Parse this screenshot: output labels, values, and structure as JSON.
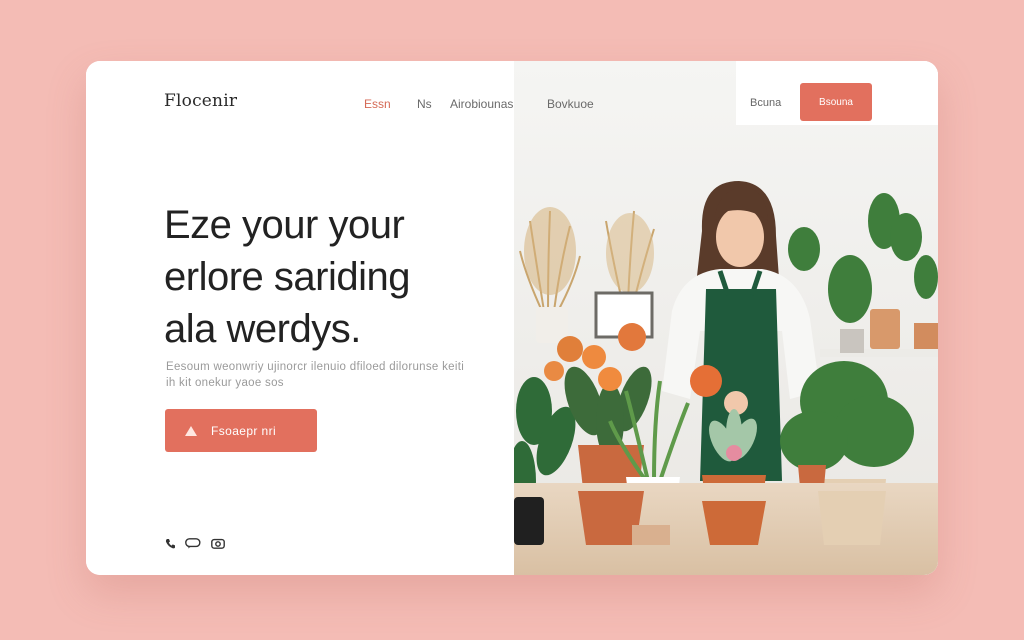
{
  "brand": {
    "logo": "Flocenir"
  },
  "nav": {
    "items": [
      {
        "label": "Essn",
        "active": true
      },
      {
        "label": "Ns",
        "active": false
      },
      {
        "label": "Airobiounas",
        "active": false
      },
      {
        "label": "Bovkuoe",
        "active": false
      }
    ],
    "login_label": "Bcuna",
    "signup_label": "Bsouna"
  },
  "hero": {
    "headline_lines": [
      "Eze your your",
      "erlore sariding",
      "ala werdys."
    ],
    "subtext": "Eesoum weonwriy ujinorcr ilenuio dfiloed dilorunse keiti ih kit onekur yaoe sos",
    "cta_label": "Fsoaepr nri"
  },
  "social": {
    "icons": [
      "phone-icon",
      "chat-icon",
      "camera-icon"
    ]
  },
  "colors": {
    "accent": "#e2705e",
    "background": "#f4bcb5",
    "nav_active": "#d56a56"
  }
}
